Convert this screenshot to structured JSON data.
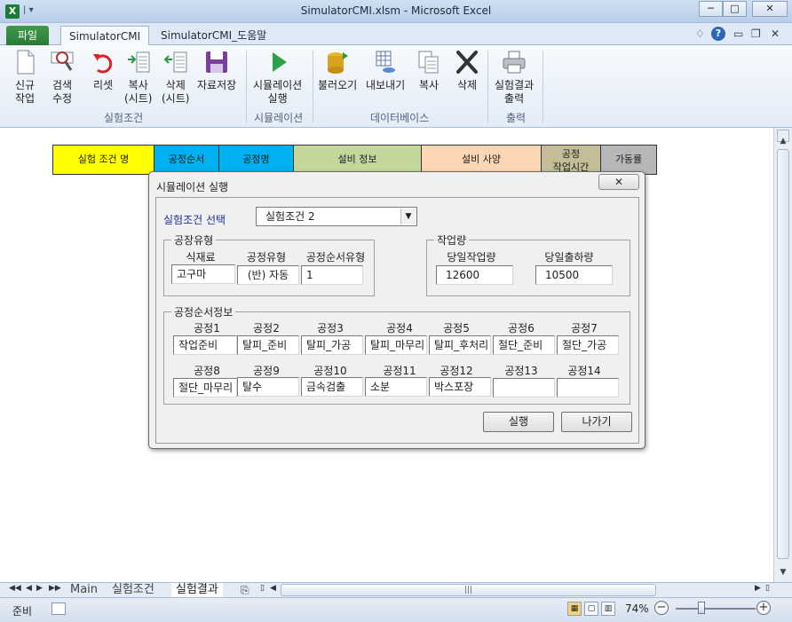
{
  "window": {
    "title": "SimulatorCMI.xlsm  -  Microsoft Excel",
    "minimize": "─",
    "maximize": "□",
    "close": "✕"
  },
  "ribbon_tabs": {
    "file": "파일",
    "tab1": "SimulatorCMI",
    "tab2": "SimulatorCMI_도움말"
  },
  "ribbon": {
    "new_l1": "신규",
    "new_l2": "작업",
    "search_l1": "검색",
    "search_l2": "수정",
    "reset": "리셋",
    "copy_sheet_l1": "복사",
    "copy_sheet_l2": "(시트)",
    "delete_sheet_l1": "삭제",
    "delete_sheet_l2": "(시트)",
    "save": "자료저장",
    "group_conditions": "실험조건",
    "simulation_l1": "시뮬레이션",
    "simulation_l2": "실행",
    "group_simulation": "시뮬레이션",
    "load": "불러오기",
    "export": "내보내기",
    "copy": "복사",
    "delete": "삭제",
    "group_database": "데이터베이스",
    "print_l1": "실험결과",
    "print_l2": "출력",
    "group_print": "출력"
  },
  "sheet_header": {
    "condition_name": "실험 조건 명",
    "process_order": "공정순서",
    "process_name": "공정명",
    "equipment_info": "설비 정보",
    "equipment_spec": "설비 사양",
    "work_time_l1": "공정",
    "work_time_l2": "작업시간",
    "utilization": "가동률"
  },
  "dialog": {
    "title": "시뮬레이션 실행",
    "close_icon": "✕",
    "select_label": "실험조건  선택",
    "selected_condition": "실험조건 2",
    "factory_type": {
      "title": "공장유형",
      "labels": [
        "식재료",
        "공정유형",
        "공정순서유형"
      ],
      "values": [
        "고구마",
        "(반) 자동",
        "1"
      ]
    },
    "workload": {
      "title": "작업량",
      "labels": [
        "당일작업량",
        "당일출하량"
      ],
      "values": [
        "12600",
        "10500"
      ]
    },
    "process_info": {
      "title": "공정순서정보",
      "labels": [
        "공정1",
        "공정2",
        "공정3",
        "공정4",
        "공정5",
        "공정6",
        "공정7",
        "공정8",
        "공정9",
        "공정10",
        "공정11",
        "공정12",
        "공정13",
        "공정14"
      ],
      "values": [
        "작업준비",
        "탈피_준비",
        "탈피_가공",
        "탈피_마무리",
        "탈피_후처리",
        "절단_준비",
        "절단_가공",
        "절단_마무리",
        "탈수",
        "금속검출",
        "소분",
        "박스포장",
        "",
        ""
      ]
    },
    "run_button": "실행",
    "exit_button": "나가기"
  },
  "sheet_tabs": {
    "nav": [
      "◀◀",
      "◀",
      "▶",
      "▶▶"
    ],
    "tabs": [
      "Main",
      "실험조건",
      "실험결과"
    ]
  },
  "status": {
    "ready": "준비",
    "zoom": "74%"
  },
  "colors": {
    "header_yellow": "#ffff00",
    "header_cyan": "#00b0f0",
    "header_green": "#c4d79b",
    "header_peach": "#fcd5b4",
    "header_tan": "#c4bd97",
    "header_gray": "#b7b7b7",
    "label_blue": "#1c2c9c",
    "file_tab_green": "#2a7a36"
  }
}
